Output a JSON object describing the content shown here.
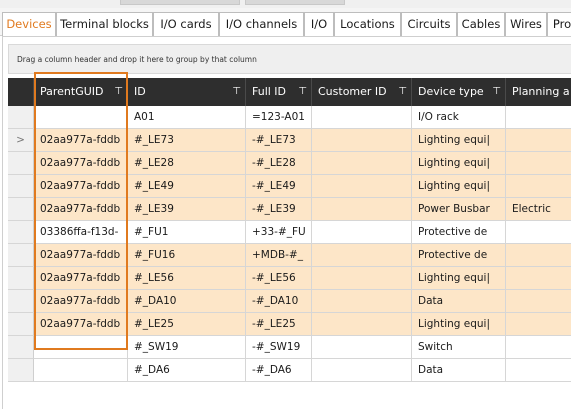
{
  "tabs": [
    {
      "label": "Devices",
      "active": true
    },
    {
      "label": "Terminal blocks"
    },
    {
      "label": "I/O cards"
    },
    {
      "label": "I/O channels"
    },
    {
      "label": "I/O"
    },
    {
      "label": "Locations"
    },
    {
      "label": "Circuits"
    },
    {
      "label": "Cables"
    },
    {
      "label": "Wires"
    },
    {
      "label": "Pro"
    }
  ],
  "group_area": {
    "text": "Drag a column header and drop it here to group by that column"
  },
  "columns": [
    "ParentGUID",
    "ID",
    "Full ID",
    "Customer ID",
    "Device type",
    "Planning a"
  ],
  "filter_glyph": "⊤",
  "current_row_indicator": ">",
  "rows": [
    {
      "parent": "",
      "id": "A01",
      "full_id": "=123-A01",
      "customer_id": "",
      "device_type": "I/O rack",
      "planning": "",
      "highlight": false,
      "current": false
    },
    {
      "parent": "02aa977a-fddb",
      "id": "#_LE73",
      "full_id": "-#_LE73",
      "customer_id": "",
      "device_type": "Lighting equi|",
      "planning": "",
      "highlight": true,
      "current": true
    },
    {
      "parent": "02aa977a-fddb",
      "id": "#_LE28",
      "full_id": "-#_LE28",
      "customer_id": "",
      "device_type": "Lighting equi|",
      "planning": "",
      "highlight": true,
      "current": false
    },
    {
      "parent": "02aa977a-fddb",
      "id": "#_LE49",
      "full_id": "-#_LE49",
      "customer_id": "",
      "device_type": "Lighting equi|",
      "planning": "",
      "highlight": true,
      "current": false
    },
    {
      "parent": "02aa977a-fddb",
      "id": "#_LE39",
      "full_id": "-#_LE39",
      "customer_id": "",
      "device_type": "Power Busbar",
      "planning": "Electric",
      "highlight": true,
      "current": false
    },
    {
      "parent": "03386ffa-f13d-",
      "id": "#_FU1",
      "full_id": "+33-#_FU",
      "customer_id": "",
      "device_type": "Protective de",
      "planning": "",
      "highlight": false,
      "current": false
    },
    {
      "parent": "02aa977a-fddb",
      "id": "#_FU16",
      "full_id": "+MDB-#_",
      "customer_id": "",
      "device_type": "Protective de",
      "planning": "",
      "highlight": true,
      "current": false
    },
    {
      "parent": "02aa977a-fddb",
      "id": "#_LE56",
      "full_id": "-#_LE56",
      "customer_id": "",
      "device_type": "Lighting equi|",
      "planning": "",
      "highlight": true,
      "current": false
    },
    {
      "parent": "02aa977a-fddb",
      "id": "#_DA10",
      "full_id": "-#_DA10",
      "customer_id": "",
      "device_type": "Data",
      "planning": "",
      "highlight": true,
      "current": false
    },
    {
      "parent": "02aa977a-fddb",
      "id": "#_LE25",
      "full_id": "-#_LE25",
      "customer_id": "",
      "device_type": "Lighting equi|",
      "planning": "",
      "highlight": true,
      "current": false
    },
    {
      "parent": "",
      "id": "#_SW19",
      "full_id": "-#_SW19",
      "customer_id": "",
      "device_type": "Switch",
      "planning": "",
      "highlight": false,
      "current": false
    },
    {
      "parent": "",
      "id": "#_DA6",
      "full_id": "-#_DA6",
      "customer_id": "",
      "device_type": "Data",
      "planning": "",
      "highlight": false,
      "current": false
    }
  ],
  "colors": {
    "accent": "#e07a1f",
    "row_highlight": "#fde6c8",
    "header_bg": "#2e2e2e"
  }
}
